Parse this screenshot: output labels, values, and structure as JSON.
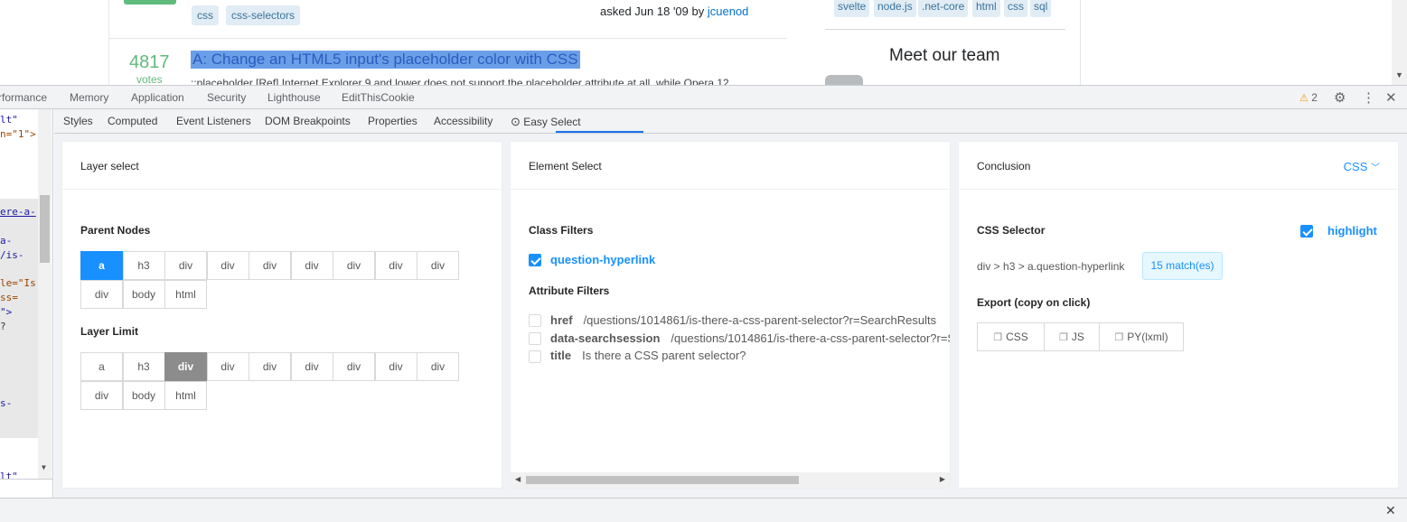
{
  "page": {
    "question_tags": [
      "css",
      "css-selectors"
    ],
    "asked_text": "asked Jun 18 '09 by",
    "asked_user": "jcuenod",
    "votes_count": "4817",
    "votes_label": "votes",
    "answer_title": "A: Change an HTML5 input's placeholder color with CSS",
    "answer_excerpt": "::placeholder [Ref] Internet Explorer 9 and lower does not support the placeholder attribute at all, while Opera 12",
    "sidebar_tags": [
      "svelte",
      "node.js",
      ".net-core",
      "html",
      "css",
      "sql"
    ],
    "meet_team": "Meet our team"
  },
  "devtools": {
    "tabs": [
      "rformance",
      "Memory",
      "Application",
      "Security",
      "Lighthouse",
      "EditThisCookie"
    ],
    "warning_count": "2",
    "sub_tabs": [
      "Styles",
      "Computed",
      "Event Listeners",
      "DOM Breakpoints",
      "Properties",
      "Accessibility",
      "Easy Select"
    ]
  },
  "dom_lines": [
    {
      "text": "lt\"",
      "kind": "val"
    },
    {
      "text": "n=\"1\">",
      "kind": "attr"
    },
    {
      "text": "ere-a-",
      "kind": "link"
    },
    {
      "text": "a-",
      "kind": "val"
    },
    {
      "text": "/is-",
      "kind": "val"
    },
    {
      "text": "le=\"Is",
      "kind": "attr"
    },
    {
      "text": "ss=",
      "kind": "attr"
    },
    {
      "text": "\">",
      "kind": "val"
    },
    {
      "text": "?",
      "kind": "plain"
    },
    {
      "text": "s-",
      "kind": "val"
    },
    {
      "text": "lt\"",
      "kind": "val"
    }
  ],
  "layer_select": {
    "title": "Layer select",
    "parent_nodes_label": "Parent Nodes",
    "parent_nodes": [
      "a",
      "h3",
      "div",
      "div",
      "div",
      "div",
      "div",
      "div",
      "div",
      "div",
      "body",
      "html"
    ],
    "parent_selected_index": 0,
    "layer_limit_label": "Layer Limit",
    "layer_limit": [
      "a",
      "h3",
      "div",
      "div",
      "div",
      "div",
      "div",
      "div",
      "div",
      "div",
      "body",
      "html"
    ],
    "limit_selected_index": 2
  },
  "element_select": {
    "title": "Element Select",
    "class_filters_label": "Class Filters",
    "class_filters": [
      {
        "name": "question-hyperlink",
        "checked": true
      }
    ],
    "attribute_filters_label": "Attribute Filters",
    "attribute_filters": [
      {
        "name": "href",
        "value": "/questions/1014861/is-there-a-css-parent-selector?r=SearchResults",
        "checked": false
      },
      {
        "name": "data-searchsession",
        "value": "/questions/1014861/is-there-a-css-parent-selector?r=SearchResults",
        "checked": false
      },
      {
        "name": "title",
        "value": "Is there a CSS parent selector?",
        "checked": false
      }
    ]
  },
  "conclusion": {
    "title": "Conclusion",
    "language": "CSS",
    "selector_label": "CSS Selector",
    "highlight_label": "highlight",
    "highlight_checked": true,
    "selector": "div > h3 > a.question-hyperlink",
    "match_count": "15 match(es)",
    "export_label": "Export (copy on click)",
    "export_buttons": [
      "CSS",
      "JS",
      "PY(lxml)"
    ]
  },
  "colors": {
    "accent": "#1890ff",
    "dark_chip": "#8c8c8c",
    "vote_green": "#5eba7d"
  }
}
